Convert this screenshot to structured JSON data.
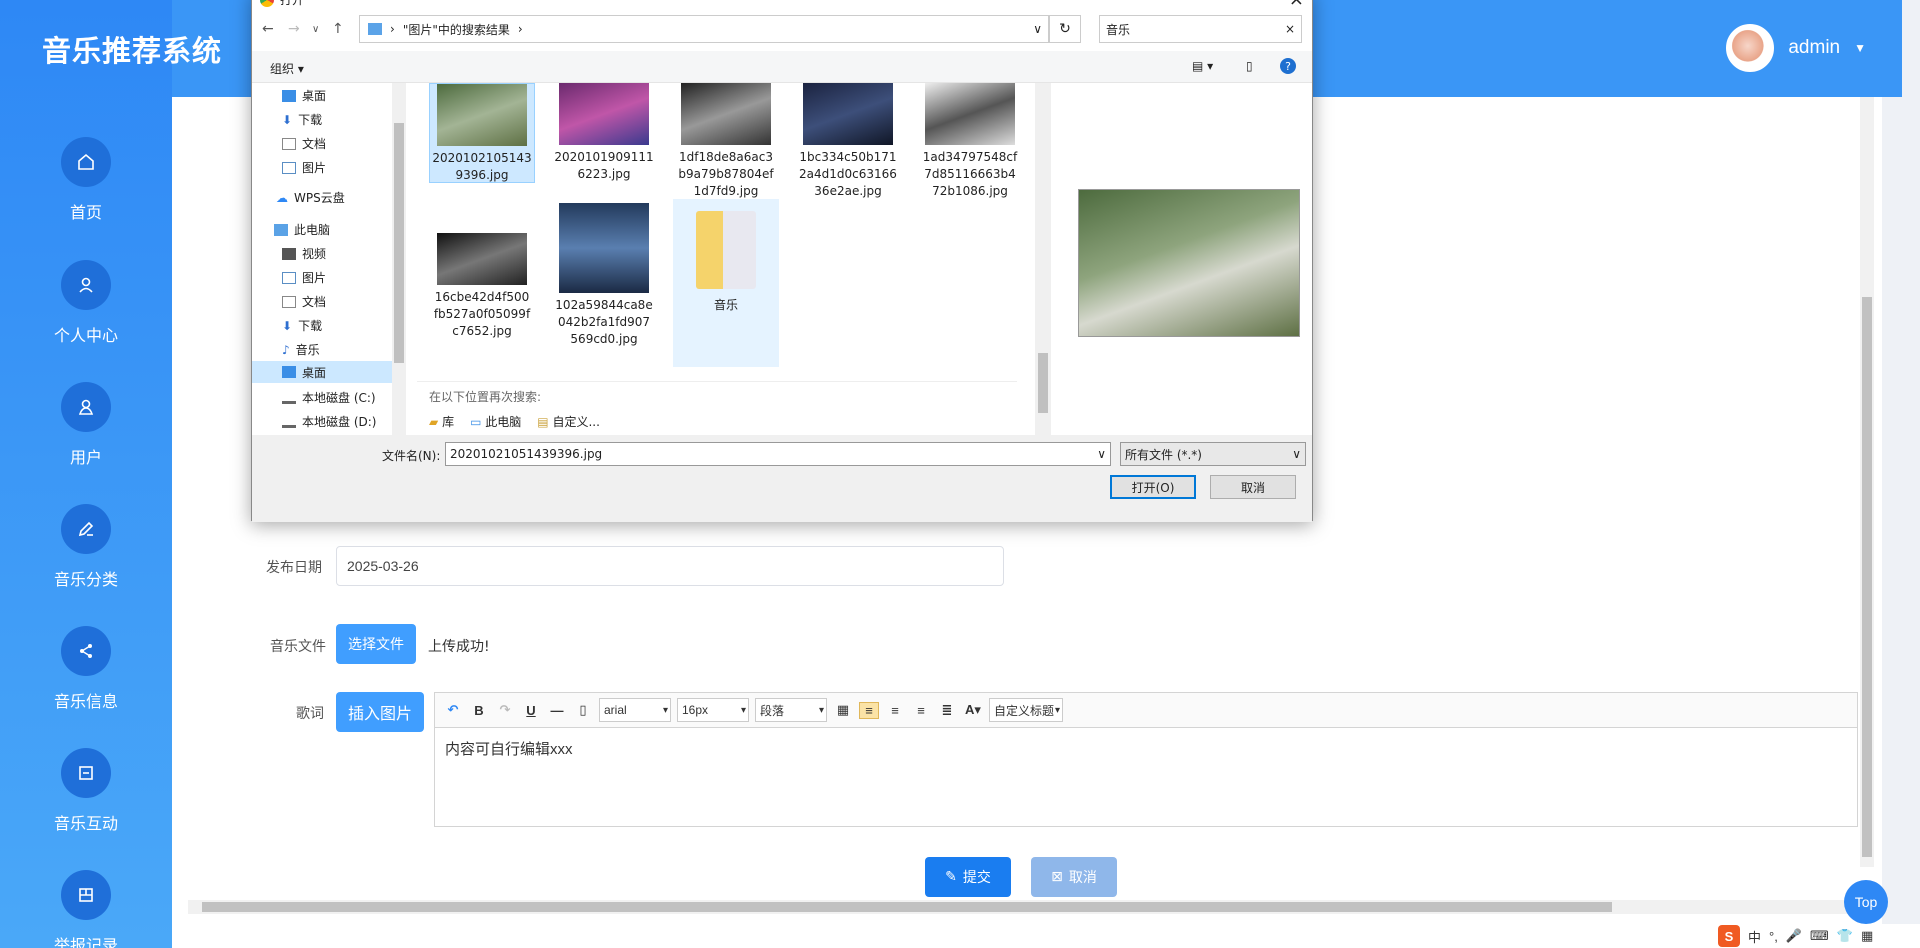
{
  "app": {
    "title": "音乐推荐系统"
  },
  "user": {
    "name": "admin"
  },
  "nav": [
    {
      "label": "首页",
      "icon": "home-icon"
    },
    {
      "label": "个人中心",
      "icon": "person-icon"
    },
    {
      "label": "用户",
      "icon": "user-icon"
    },
    {
      "label": "音乐分类",
      "icon": "pen-icon"
    },
    {
      "label": "音乐信息",
      "icon": "share-icon"
    },
    {
      "label": "音乐互动",
      "icon": "box-icon"
    },
    {
      "label": "举报记录",
      "icon": "grid-icon"
    }
  ],
  "form": {
    "date_label": "发布日期",
    "date_value": "2025-03-26",
    "file_label": "音乐文件",
    "file_button": "选择文件",
    "file_status": "上传成功!",
    "lyrics_label": "歌词",
    "insert_image": "插入图片",
    "submit": "提交",
    "cancel": "取消"
  },
  "editor": {
    "font": "arial",
    "size": "16px",
    "paragraph": "段落",
    "custom_title": "自定义标题",
    "content": "内容可自行编辑xxx"
  },
  "top_button": "Top",
  "tray": {
    "ime": "中"
  },
  "dialog": {
    "title": "打开",
    "address": "\"图片\"中的搜索结果",
    "search": "音乐",
    "organize": "组织",
    "tree": [
      {
        "label": "桌面"
      },
      {
        "label": "下载"
      },
      {
        "label": "文档"
      },
      {
        "label": "图片"
      },
      {
        "label": "WPS云盘"
      },
      {
        "label": "此电脑"
      },
      {
        "label": "视频"
      },
      {
        "label": "图片"
      },
      {
        "label": "文档"
      },
      {
        "label": "下载"
      },
      {
        "label": "音乐"
      },
      {
        "label": "桌面"
      },
      {
        "label": "本地磁盘 (C:)"
      },
      {
        "label": "本地磁盘 (D:)"
      }
    ],
    "files": [
      {
        "name": "20201021051439396.jpg",
        "l1": "2020102105143",
        "l2": "9396.jpg"
      },
      {
        "name": "20201019091116223.jpg",
        "l1": "2020101909111",
        "l2": "6223.jpg"
      },
      {
        "name": "1df18de8a6ac3b9a79b87804ef1d7fd9.jpg",
        "l1": "1df18de8a6ac3",
        "l2": "b9a79b87804ef",
        "l3": "1d7fd9.jpg"
      },
      {
        "name": "1bc334c50b1712a4d1d0c6316636e2ae.jpg",
        "l1": "1bc334c50b171",
        "l2": "2a4d1d0c63166",
        "l3": "36e2ae.jpg"
      },
      {
        "name": "1ad34797548cf7d85116663b472b1086.jpg",
        "l1": "1ad34797548cf",
        "l2": "7d85116663b4",
        "l3": "72b1086.jpg"
      },
      {
        "name": "16cbe42d4f500fb527a0f05099fc7652.jpg",
        "l1": "16cbe42d4f500",
        "l2": "fb527a0f05099f",
        "l3": "c7652.jpg"
      },
      {
        "name": "102a59844ca8e042b2fa1fd907569cd0.jpg",
        "l1": "102a59844ca8e",
        "l2": "042b2fa1fd907",
        "l3": "569cd0.jpg"
      },
      {
        "name": "音乐",
        "l1": "音乐"
      }
    ],
    "search_again": "在以下位置再次搜索:",
    "locations": [
      "库",
      "此电脑",
      "自定义..."
    ],
    "filename_label": "文件名(N):",
    "filename_value": "20201021051439396.jpg",
    "filetype": "所有文件 (*.*)",
    "open": "打开(O)",
    "cancel": "取消"
  }
}
